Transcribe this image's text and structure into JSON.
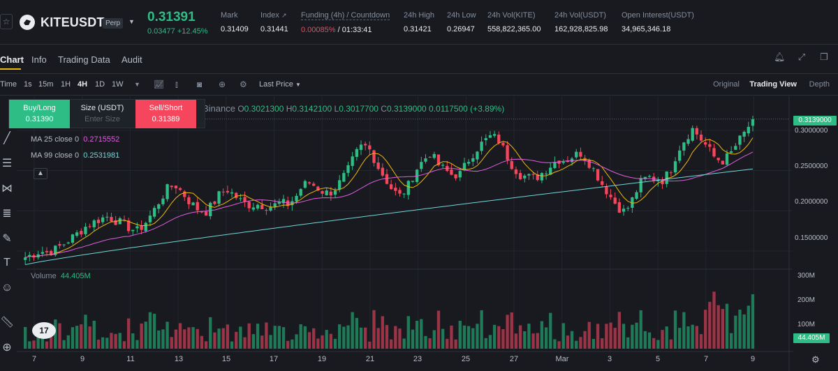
{
  "header": {
    "symbol": "KITEUSDT",
    "contract_tag": "Perp",
    "last_price": "0.31391",
    "change": "0.03477 +12.45%",
    "stats": {
      "mark_label": "Mark",
      "mark_value": "0.31409",
      "index_label": "Index",
      "index_value": "0.31441",
      "funding_label": "Funding (4h) / Countdown",
      "funding_rate": "0.00085%",
      "funding_countdown": "/ 01:33:41",
      "high_label": "24h High",
      "high_value": "0.31421",
      "low_label": "24h Low",
      "low_value": "0.26947",
      "vol_kite_label": "24h Vol(KITE)",
      "vol_kite_value": "558,822,365.00",
      "vol_usdt_label": "24h Vol(USDT)",
      "vol_usdt_value": "162,928,825.98",
      "oi_label": "Open Interest(USDT)",
      "oi_value": "34,965,346.18"
    }
  },
  "tabs": [
    "Chart",
    "Info",
    "Trading Data",
    "Audit"
  ],
  "toolbar": {
    "time_label": "Time",
    "intervals": [
      "1s",
      "15m",
      "1H",
      "4H",
      "1D",
      "1W"
    ],
    "active_interval": "4H",
    "price_mode": "Last Price",
    "views": [
      "Original",
      "Trading View",
      "Depth"
    ]
  },
  "order_panel": {
    "buy_label": "Buy/Long",
    "buy_price": "0.31390",
    "size_label": "Size (USDT)",
    "size_placeholder": "Enter Size",
    "sell_label": "Sell/Short",
    "sell_price": "0.31389"
  },
  "legend": {
    "exchange": "Binance",
    "o_label": "O",
    "o_value": "0.3021300",
    "h_label": "H",
    "h_value": "0.3142100",
    "l_label": "L",
    "l_value": "0.3017700",
    "c_label": "C",
    "c_value": "0.3139000",
    "change": "0.0117500 (+3.89%)",
    "ma25_label": "MA 25 close 0",
    "ma25_value": "0.2715552",
    "ma99_label": "MA 99 close 0",
    "ma99_value": "0.2531981",
    "volume_label": "Volume",
    "volume_value": "44.405M"
  },
  "price_axis": [
    "0.3000000",
    "0.2500000",
    "0.2000000",
    "0.1500000"
  ],
  "current_price_tag": "0.3139000",
  "volume_axis": [
    "300M",
    "200M",
    "100M"
  ],
  "volume_tag": "44.405M",
  "x_axis": [
    "7",
    "9",
    "11",
    "13",
    "15",
    "17",
    "19",
    "21",
    "23",
    "25",
    "27",
    "Mar",
    "3",
    "5",
    "7",
    "9"
  ],
  "colors": {
    "up": "#2ebd85",
    "down": "#f6465d",
    "ma7": "#f0b90b",
    "ma25": "#e05ee0",
    "ma99": "#70d8d8",
    "bg": "#181a20"
  },
  "chart_data": {
    "type": "candlestick",
    "ylim": [
      0.13,
      0.325
    ],
    "price_series": [
      0.142,
      0.146,
      0.15,
      0.148,
      0.152,
      0.158,
      0.165,
      0.172,
      0.18,
      0.185,
      0.19,
      0.193,
      0.188,
      0.184,
      0.178,
      0.175,
      0.185,
      0.198,
      0.214,
      0.228,
      0.232,
      0.222,
      0.21,
      0.202,
      0.198,
      0.208,
      0.222,
      0.226,
      0.218,
      0.21,
      0.207,
      0.208,
      0.206,
      0.206,
      0.21,
      0.208,
      0.216,
      0.232,
      0.235,
      0.228,
      0.222,
      0.224,
      0.236,
      0.25,
      0.27,
      0.282,
      0.275,
      0.255,
      0.24,
      0.225,
      0.218,
      0.23,
      0.25,
      0.262,
      0.272,
      0.258,
      0.25,
      0.244,
      0.246,
      0.262,
      0.275,
      0.285,
      0.292,
      0.29,
      0.272,
      0.255,
      0.245,
      0.242,
      0.24,
      0.248,
      0.256,
      0.264,
      0.262,
      0.268,
      0.272,
      0.262,
      0.248,
      0.232,
      0.218,
      0.205,
      0.198,
      0.215,
      0.235,
      0.242,
      0.24,
      0.238,
      0.25,
      0.275,
      0.29,
      0.302,
      0.29,
      0.278,
      0.265,
      0.262,
      0.27,
      0.285,
      0.298,
      0.3139
    ],
    "ma99_range": [
      0.133,
      0.252
    ]
  }
}
